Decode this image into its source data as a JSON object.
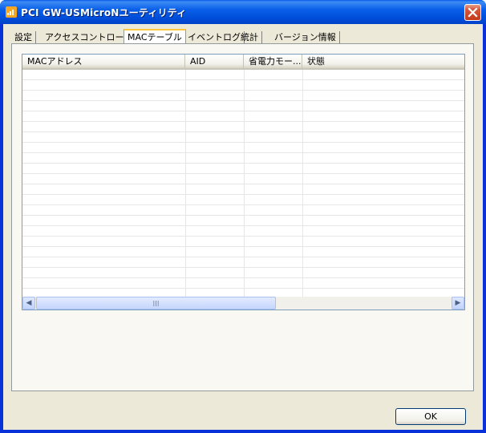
{
  "window": {
    "title": "PCI GW-USMicroNユーティリティ",
    "icon": "utility-app-icon",
    "close_icon": "close-icon"
  },
  "tabs": [
    {
      "label": "設定",
      "active": false
    },
    {
      "label": "アクセスコントロール",
      "active": false
    },
    {
      "label": "MACテーブル",
      "active": true
    },
    {
      "label": "イベントログ",
      "active": false
    },
    {
      "label": "統計",
      "active": false
    },
    {
      "label": "バージョン情報",
      "active": false
    }
  ],
  "mac_table": {
    "columns": [
      "MACアドレス",
      "AID",
      "省電力モー...",
      "状態"
    ],
    "rows": []
  },
  "scrollbar": {
    "left_icon": "scroll-left-icon",
    "right_icon": "scroll-right-icon"
  },
  "buttons": {
    "ok": "OK"
  },
  "colors": {
    "titlebar": "#0054e3",
    "dialog_bg": "#ece9d8",
    "close_button": "#c23a1a",
    "active_tab_accent": "#ffc83c"
  }
}
